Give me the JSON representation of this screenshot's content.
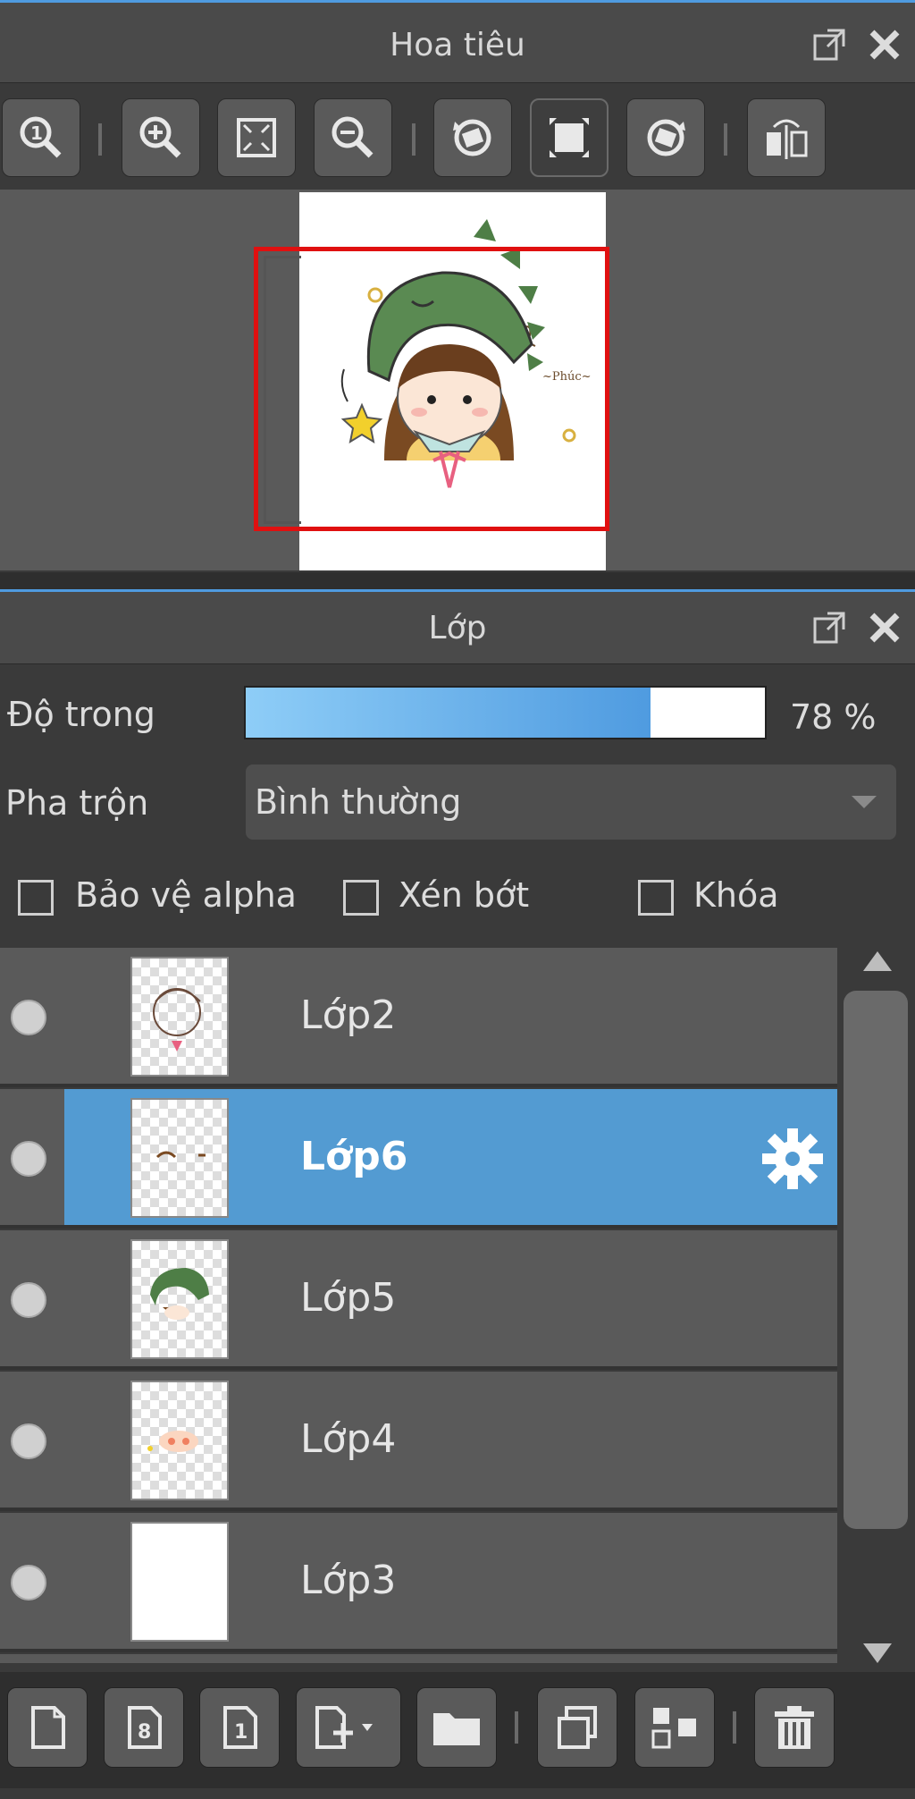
{
  "navigator": {
    "title": "Hoa tiêu",
    "toolbar_icons": [
      "zoom-100-icon",
      "zoom-in-icon",
      "fit-window-icon",
      "zoom-out-icon",
      "rotate-left-icon",
      "fullscreen-icon",
      "rotate-right-icon",
      "flip-horizontal-icon"
    ]
  },
  "layers_panel": {
    "title": "Lớp",
    "opacity_label": "Độ trong",
    "opacity_value": "78 %",
    "opacity_percent": 78,
    "blend_label": "Pha trộn",
    "blend_value": "Bình thường",
    "checkbox_alpha": "Bảo vệ alpha",
    "checkbox_clip": "Xén bớt",
    "checkbox_lock": "Khóa",
    "layers": [
      {
        "name": "Lớp2",
        "selected": false
      },
      {
        "name": "Lớp6",
        "selected": true
      },
      {
        "name": "Lớp5",
        "selected": false
      },
      {
        "name": "Lớp4",
        "selected": false
      },
      {
        "name": "Lớp3",
        "selected": false
      }
    ]
  },
  "colors": {
    "accent": "#4f9be0",
    "selection": "#539bd2",
    "viewport_frame": "#e01010"
  }
}
